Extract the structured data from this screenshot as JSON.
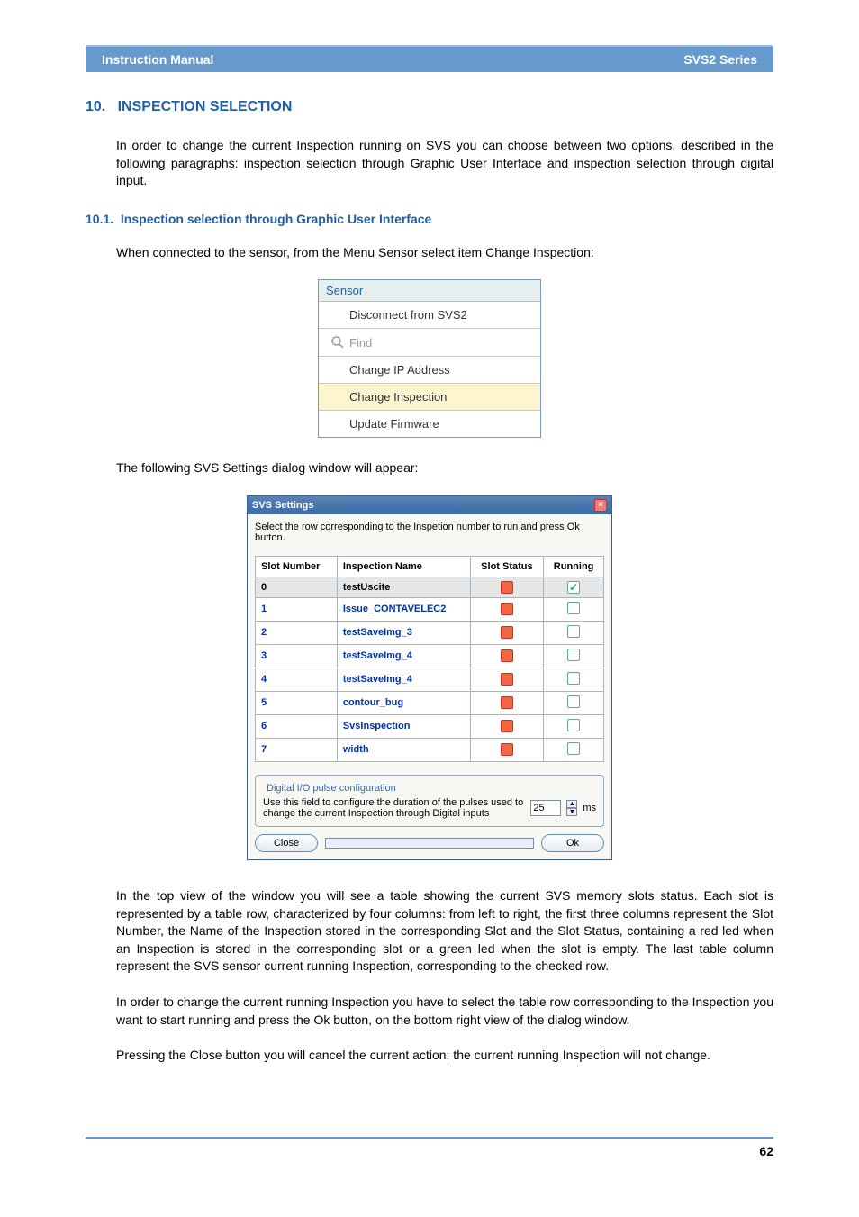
{
  "header": {
    "left": "Instruction Manual",
    "right": "SVS2 Series"
  },
  "section": {
    "number": "10.",
    "title": "INSPECTION SELECTION",
    "intro": "In order to change the current Inspection running on SVS you can choose between two options, described in the following paragraphs: inspection selection through Graphic User Interface and inspection selection through digital input."
  },
  "subsection": {
    "number": "10.1.",
    "title": "Inspection selection through Graphic User Interface",
    "line1": "When connected to the sensor, from the Menu Sensor select item Change Inspection:",
    "line2": "The following SVS Settings dialog window will appear:"
  },
  "menu": {
    "title": "Sensor",
    "items": [
      {
        "label": "Disconnect from SVS2",
        "disabled": false,
        "highlight": false,
        "icon": null
      },
      {
        "label": "Find",
        "disabled": true,
        "highlight": false,
        "icon": "search"
      },
      {
        "label": "Change IP Address",
        "disabled": false,
        "highlight": false,
        "icon": null
      },
      {
        "label": "Change Inspection",
        "disabled": false,
        "highlight": true,
        "icon": null
      },
      {
        "label": "Update Firmware",
        "disabled": false,
        "highlight": false,
        "icon": null
      }
    ]
  },
  "dialog": {
    "title": "SVS Settings",
    "instruction": "Select the row corresponding to the Inspetion number to run and press Ok button.",
    "columns": {
      "c1": "Slot Number",
      "c2": "Inspection Name",
      "c3": "Slot Status",
      "c4": "Running"
    },
    "rows": [
      {
        "slot": "0",
        "name": "testUscite",
        "status": "red",
        "running": true,
        "selected": true
      },
      {
        "slot": "1",
        "name": "Issue_CONTAVELEC2",
        "status": "red",
        "running": false,
        "selected": false
      },
      {
        "slot": "2",
        "name": "testSaveImg_3",
        "status": "red",
        "running": false,
        "selected": false
      },
      {
        "slot": "3",
        "name": "testSaveImg_4",
        "status": "red",
        "running": false,
        "selected": false
      },
      {
        "slot": "4",
        "name": "testSaveImg_4",
        "status": "red",
        "running": false,
        "selected": false
      },
      {
        "slot": "5",
        "name": "contour_bug",
        "status": "red",
        "running": false,
        "selected": false
      },
      {
        "slot": "6",
        "name": "SvsInspection",
        "status": "red",
        "running": false,
        "selected": false
      },
      {
        "slot": "7",
        "name": "width",
        "status": "red",
        "running": false,
        "selected": false
      }
    ],
    "pulse": {
      "legend": "Digital I/O pulse configuration",
      "msg": "Use this field to configure the duration of the pulses used to change the current Inspection through Digital inputs",
      "value": "25",
      "unit": "ms"
    },
    "buttons": {
      "close": "Close",
      "ok": "Ok"
    }
  },
  "para": {
    "p1": "In the top view of the window you will see a table showing the current SVS memory slots status. Each slot is represented by a table row, characterized by four columns: from left to right, the first three columns represent the Slot Number, the Name of the Inspection stored in the corresponding Slot and the Slot Status, containing a red led when an Inspection is stored in the corresponding slot or a green led when the slot is empty. The last table column represent the SVS sensor current running Inspection, corresponding to the checked row.",
    "p2": "In order to change the current running Inspection you have to select the table row corresponding to the Inspection you want to start running and press the Ok button, on the bottom right view of the dialog window.",
    "p3": "Pressing the Close button you will cancel the current action; the current running Inspection will not change."
  },
  "page_number": "62"
}
